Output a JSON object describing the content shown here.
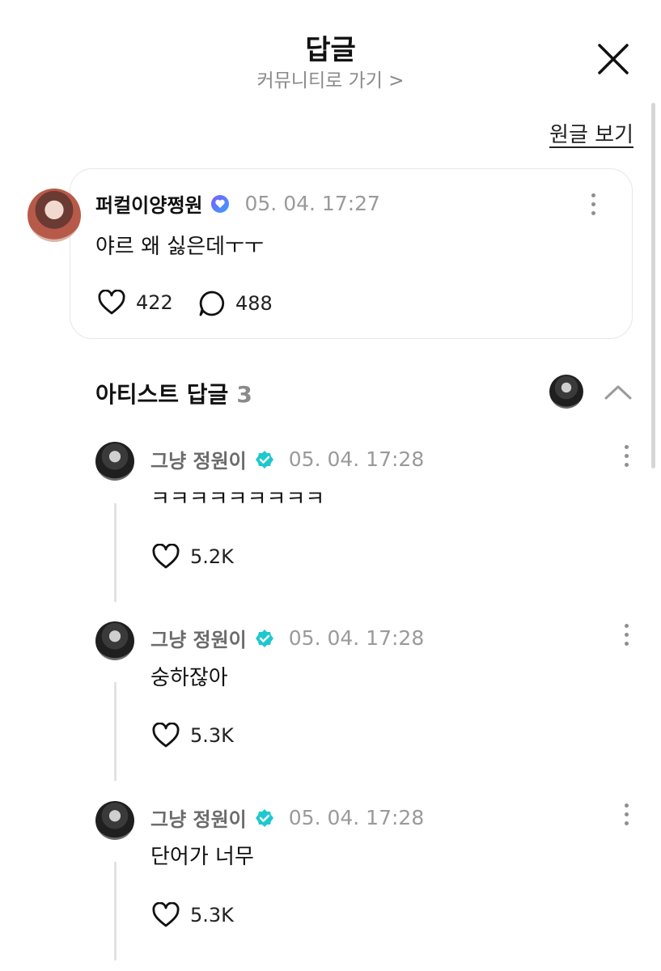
{
  "header": {
    "title": "답글",
    "subtitle": "커뮤니티로 가기 >"
  },
  "view_original": "원글 보기",
  "post": {
    "author": "퍼컬이양쩡원",
    "time": "05. 04. 17:27",
    "text": "야르 왜 싫은데ㅜㅜ",
    "likes": "422",
    "comments": "488"
  },
  "artist_section": {
    "title": "아티스트 답글",
    "count": "3"
  },
  "replies": [
    {
      "author": "그냥 정원이",
      "time": "05. 04. 17:28",
      "text": "ㅋㅋㅋㅋㅋㅋㅋㅋㅋ",
      "likes": "5.2K"
    },
    {
      "author": "그냥 정원이",
      "time": "05. 04. 17:28",
      "text": "숭하잖아",
      "likes": "5.3K"
    },
    {
      "author": "그냥 정원이",
      "time": "05. 04. 17:28",
      "text": "단어가 너무",
      "likes": "5.3K"
    }
  ],
  "colors": {
    "verified_badge": "#1ec8cf",
    "fan_badge_start": "#7c5cff",
    "fan_badge_end": "#3aa0ff"
  },
  "icons": [
    "close-icon",
    "more-vertical-icon",
    "heart-icon",
    "comment-bubble-icon",
    "chevron-up-icon",
    "verified-badge-icon"
  ]
}
